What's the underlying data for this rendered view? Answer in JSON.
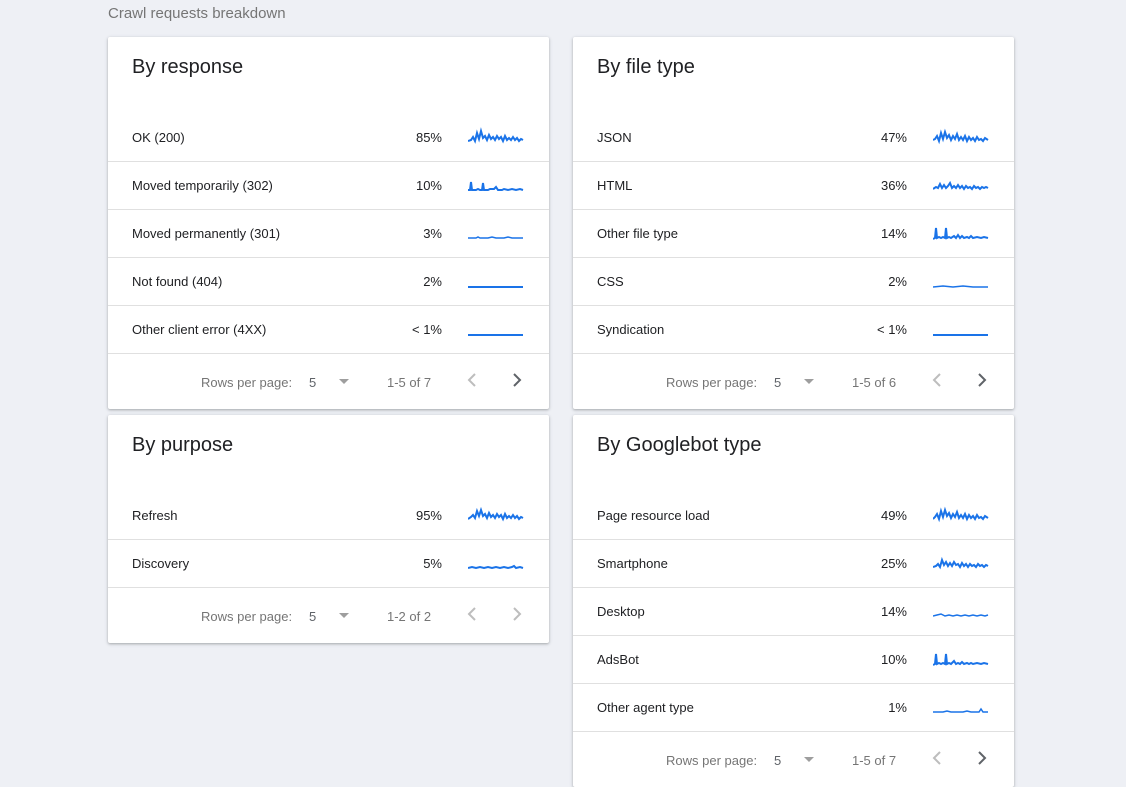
{
  "section_title": "Crawl requests breakdown",
  "sparkline_color": "#1a73e8",
  "footer_labels": {
    "rows_per_page": "Rows per page:"
  },
  "cards": {
    "response": {
      "title": "By response",
      "rows": [
        {
          "label": "OK (200)",
          "pct": "85%"
        },
        {
          "label": "Moved temporarily (302)",
          "pct": "10%"
        },
        {
          "label": "Moved permanently (301)",
          "pct": "3%"
        },
        {
          "label": "Not found (404)",
          "pct": "2%"
        },
        {
          "label": "Other client error (4XX)",
          "pct": "< 1%"
        }
      ],
      "rows_per_page": "5",
      "range": "1-5 of 7"
    },
    "file_type": {
      "title": "By file type",
      "rows": [
        {
          "label": "JSON",
          "pct": "47%"
        },
        {
          "label": "HTML",
          "pct": "36%"
        },
        {
          "label": "Other file type",
          "pct": "14%"
        },
        {
          "label": "CSS",
          "pct": "2%"
        },
        {
          "label": "Syndication",
          "pct": "< 1%"
        }
      ],
      "rows_per_page": "5",
      "range": "1-5 of 6"
    },
    "purpose": {
      "title": "By purpose",
      "rows": [
        {
          "label": "Refresh",
          "pct": "95%"
        },
        {
          "label": "Discovery",
          "pct": "5%"
        }
      ],
      "rows_per_page": "5",
      "range": "1-2 of 2"
    },
    "googlebot": {
      "title": "By Googlebot type",
      "rows": [
        {
          "label": "Page resource load",
          "pct": "49%"
        },
        {
          "label": "Smartphone",
          "pct": "25%"
        },
        {
          "label": "Desktop",
          "pct": "14%"
        },
        {
          "label": "AdsBot",
          "pct": "10%"
        },
        {
          "label": "Other agent type",
          "pct": "1%"
        }
      ],
      "rows_per_page": "5",
      "range": "1-5 of 7"
    }
  }
}
